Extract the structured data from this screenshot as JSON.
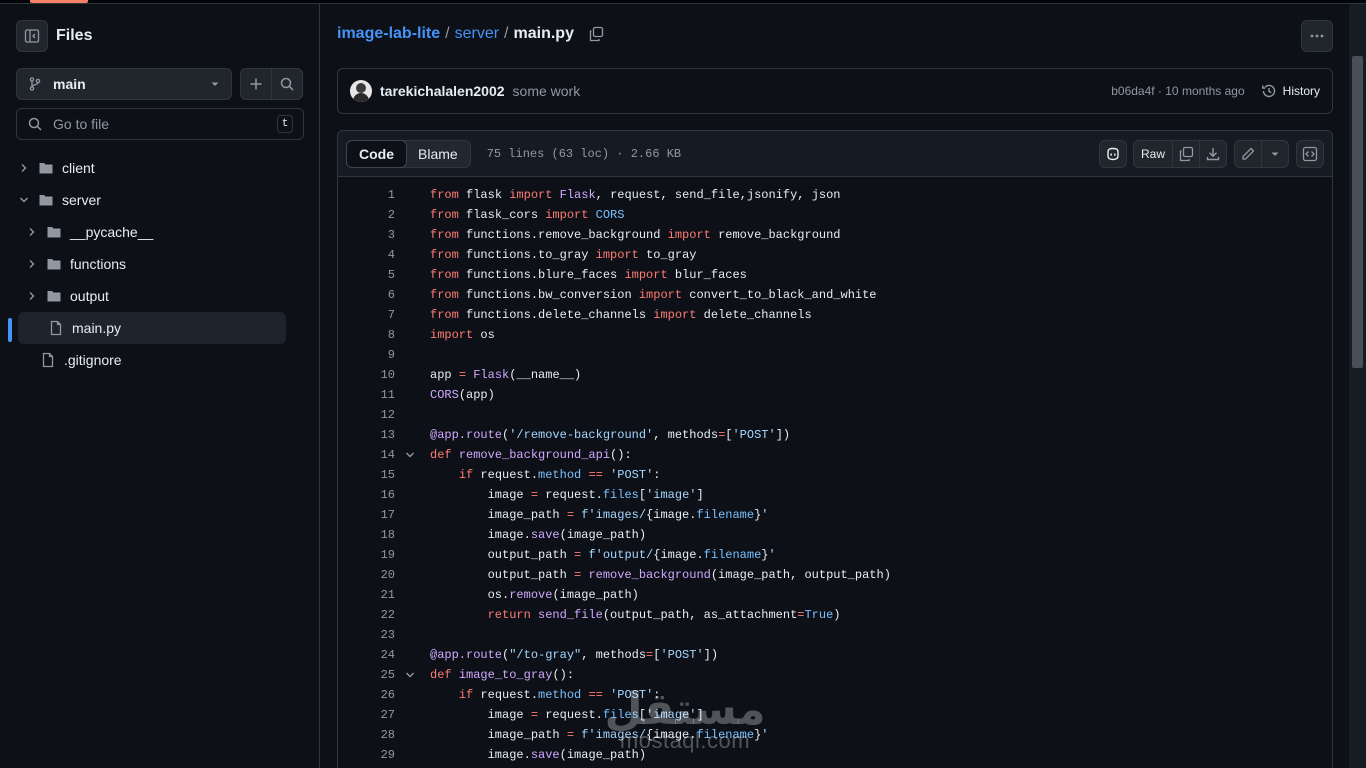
{
  "sidebar": {
    "title": "Files",
    "branch": "main",
    "goto_placeholder": "Go to file",
    "goto_shortcut": "t",
    "tree": [
      {
        "label": "client",
        "type": "folder",
        "expanded": false
      },
      {
        "label": "server",
        "type": "folder",
        "expanded": true
      },
      {
        "label": "__pycache__",
        "type": "folder",
        "expanded": false
      },
      {
        "label": "functions",
        "type": "folder",
        "expanded": false
      },
      {
        "label": "output",
        "type": "folder",
        "expanded": false
      },
      {
        "label": "main.py",
        "type": "file",
        "selected": true
      },
      {
        "label": ".gitignore",
        "type": "file"
      }
    ]
  },
  "breadcrumb": {
    "repo": "image-lab-lite",
    "folder": "server",
    "file": "main.py"
  },
  "commit": {
    "author": "tarekichalalen2002",
    "message": "some work",
    "meta": "b06da4f · 10 months ago",
    "history_label": "History"
  },
  "code_header": {
    "code_tab": "Code",
    "blame_tab": "Blame",
    "file_info": "75 lines (63 loc) · 2.66 KB",
    "raw_label": "Raw"
  },
  "code_lines": [
    "1",
    "2",
    "3",
    "4",
    "5",
    "6",
    "7",
    "8",
    "9",
    "10",
    "11",
    "12",
    "13",
    "14",
    "15",
    "16",
    "17",
    "18",
    "19",
    "20",
    "21",
    "22",
    "23",
    "24",
    "25",
    "26",
    "27",
    "28",
    "29"
  ],
  "watermark": {
    "arabic": "مستقل",
    "latin": "mostaql.com"
  },
  "colors": {
    "background": "#0d1117",
    "accent": "#4493f8",
    "keyword": "#ff7b72",
    "function": "#d2a8ff",
    "string": "#a5d6ff",
    "constant": "#79c0ff"
  }
}
